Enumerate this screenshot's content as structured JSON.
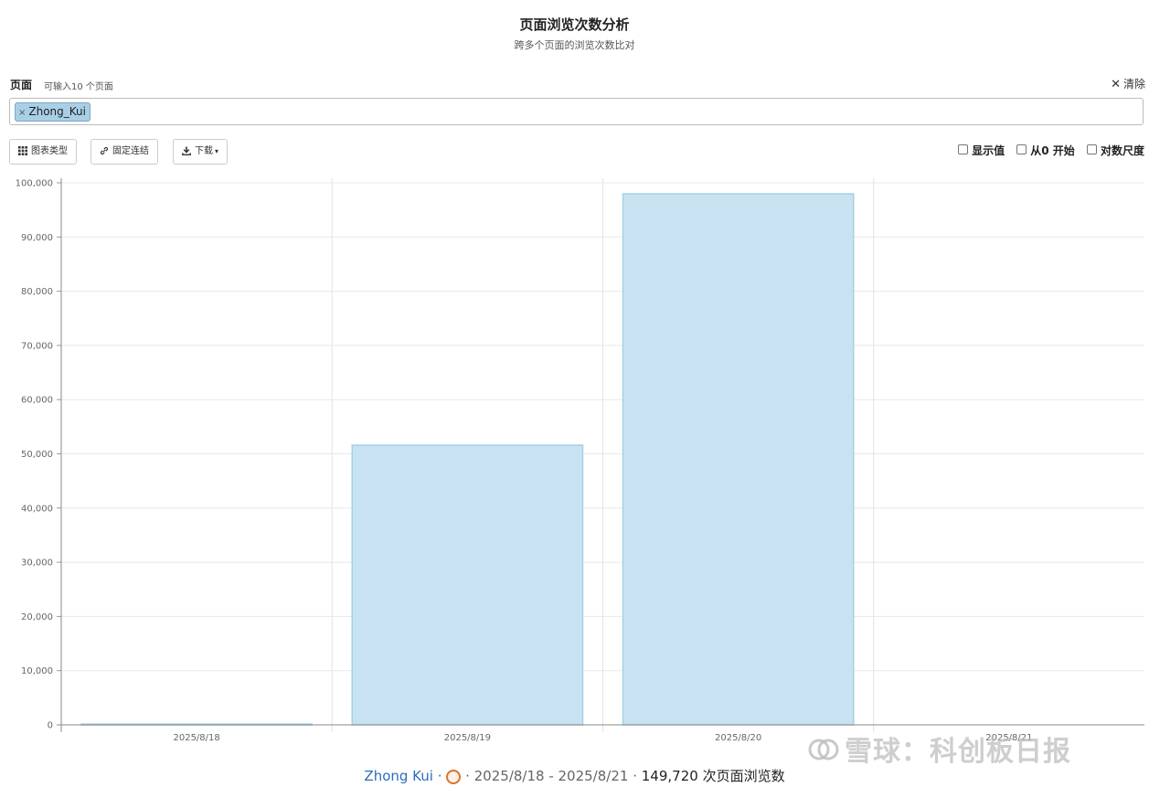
{
  "header": {
    "title": "页面浏览次数分析",
    "subtitle": "跨多个页面的浏览次数比对"
  },
  "pages_field": {
    "label": "页面",
    "hint": "可输入10 个页面",
    "clear_label": "清除",
    "tags": [
      "Zhong_Kui"
    ]
  },
  "toolbar": {
    "chart_type_label": "图表类型",
    "permalink_label": "固定连结",
    "download_label": "下载"
  },
  "options": {
    "show_values": "显示值",
    "from_zero": "从0 开始",
    "log_scale": "对数尺度"
  },
  "chart_data": {
    "type": "bar",
    "categories": [
      "2025/8/18",
      "2025/8/19",
      "2025/8/20",
      "2025/8/21"
    ],
    "series": [
      {
        "values": [
          150,
          51600,
          97970,
          0
        ]
      }
    ],
    "ylim": [
      0,
      100000
    ],
    "yticks": [
      0,
      10000,
      20000,
      30000,
      40000,
      50000,
      60000,
      70000,
      80000,
      90000,
      100000
    ],
    "ytick_labels": [
      "0",
      "10,000",
      "20,000",
      "30,000",
      "40,000",
      "50,000",
      "60,000",
      "70,000",
      "80,000",
      "90,000",
      "100,000"
    ],
    "grid": true,
    "bar_color": "#c9e2f1",
    "bar_edge_color": "#a7cfe6"
  },
  "footer": {
    "page": "Zhong Kui",
    "sep": "·",
    "date_range": "2025/8/18 - 2025/8/21",
    "total": "149,720 次页面浏览数"
  },
  "watermark": {
    "text": "雪球：科创板日报"
  }
}
